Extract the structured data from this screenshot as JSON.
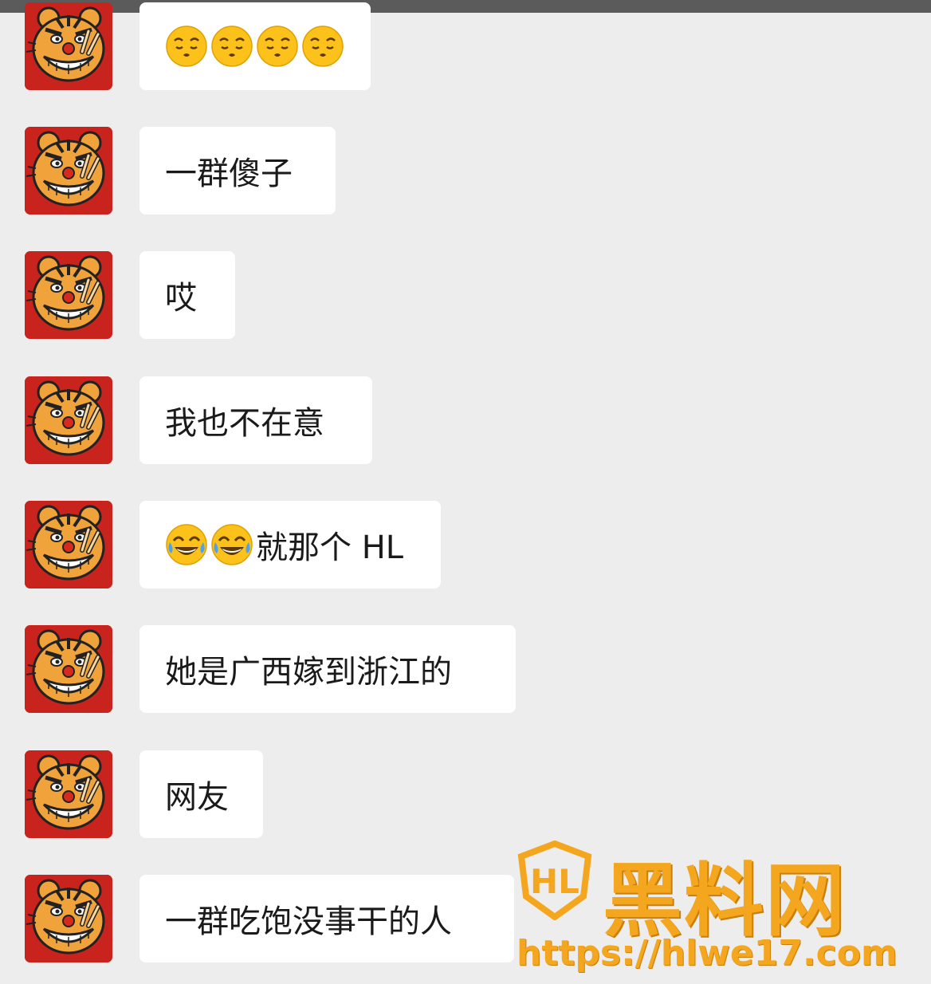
{
  "messages": [
    {
      "text": "",
      "emojis": [
        "kissing-face",
        "kissing-face",
        "kissing-face",
        "kissing-face"
      ]
    },
    {
      "text": "一群傻子",
      "emojis": []
    },
    {
      "text": "哎",
      "emojis": []
    },
    {
      "text": "我也不在意",
      "emojis": []
    },
    {
      "text": "就那个 HL",
      "emojis": [
        "tears-of-joy",
        "tears-of-joy"
      ]
    },
    {
      "text": "她是广西嫁到浙江的",
      "emojis": []
    },
    {
      "text": "网友",
      "emojis": []
    },
    {
      "text": "一群吃饱没事干的人",
      "emojis": []
    }
  ],
  "watermark": {
    "brand": "黑料网",
    "url": "https://hlwe17.com"
  }
}
